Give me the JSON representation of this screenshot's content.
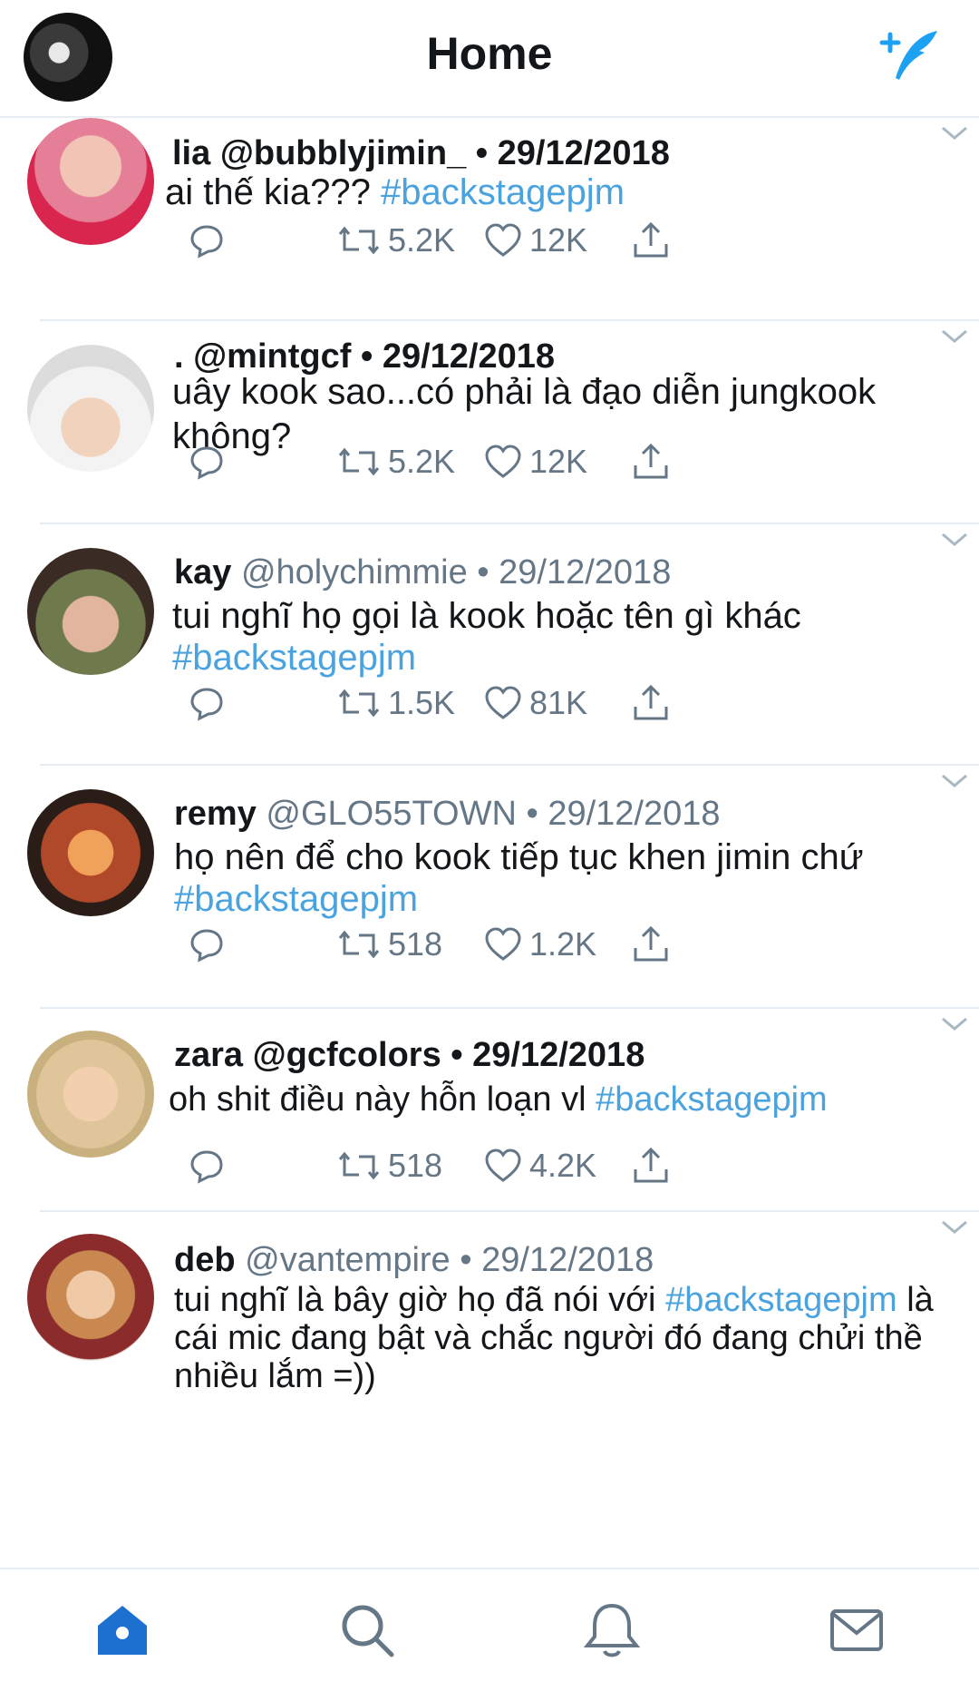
{
  "header": {
    "title": "Home"
  },
  "colors": {
    "accent": "#1da1f2",
    "hashtag": "#4aa3df",
    "muted": "#657786",
    "divider": "#e6ecf0"
  },
  "tweets": [
    {
      "name": "lia",
      "handle": "@bubblyjimin_",
      "date": "• 29/12/2018",
      "text": "ai thế kia???",
      "tag": "#backstagepjm",
      "tail": "",
      "retweets": "5.2K",
      "likes": "12K"
    },
    {
      "name": ".",
      "handle": "@mintgcf",
      "date": "• 29/12/2018",
      "text": "uây kook sao...có phải là đạo diễn jungkook không?",
      "tag": "",
      "tail": "",
      "retweets": "5.2K",
      "likes": "12K"
    },
    {
      "name": "kay",
      "handle": "@holychimmie",
      "date": "• 29/12/2018",
      "text": " tui nghĩ họ gọi là kook hoặc tên gì khác",
      "tag": "#backstagepjm",
      "tail": "",
      "retweets": "1.5K",
      "likes": "81K"
    },
    {
      "name": "remy",
      "handle": "@GLO55TOWN",
      "date": "• 29/12/2018",
      "text": "họ nên để cho kook tiếp tục khen jimin chứ",
      "tag": "#backstagepjm",
      "tail": "",
      "retweets": "518",
      "likes": "1.2K"
    },
    {
      "name": "zara",
      "handle": "@gcfcolors",
      "date": "• 29/12/2018",
      "text": "oh shit điều này hỗn loạn vl ",
      "tag": "#backstagepjm",
      "tail": "",
      "retweets": "518",
      "likes": "4.2K"
    },
    {
      "name": "deb",
      "handle": "@vantempire",
      "date": "• 29/12/2018",
      "text": "tui nghĩ là bây giờ họ đã nói với ",
      "tag": "#backstagepjm",
      "tail": " là cái mic đang bật và chắc người đó đang chửi thề nhiều lắm =))",
      "retweets": "",
      "likes": ""
    }
  ],
  "tabs": [
    "home-icon",
    "search-icon",
    "notifications-icon",
    "messages-icon"
  ]
}
